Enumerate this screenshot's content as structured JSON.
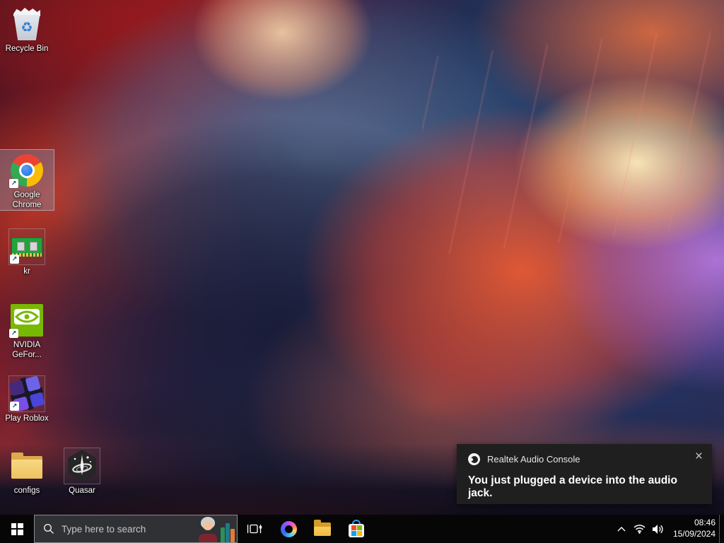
{
  "desktop_icons": {
    "recycle_bin": {
      "label": "Recycle Bin"
    },
    "google_chrome": {
      "line1": "Google",
      "line2": "Chrome",
      "selected": true
    },
    "kr": {
      "label": "kr"
    },
    "nvidia_geforce": {
      "line1": "NVIDIA",
      "line2": "GeFor..."
    },
    "play_roblox": {
      "label": "Play Roblox"
    },
    "configs": {
      "label": "configs"
    },
    "quasar": {
      "label": "Quasar"
    }
  },
  "notification": {
    "app_name": "Realtek Audio Console",
    "message": "You just plugged a device into the audio jack.",
    "close_glyph": "×"
  },
  "taskbar": {
    "search_placeholder": "Type here to search",
    "clock": {
      "time": "08:46",
      "date": "15/09/2024"
    }
  },
  "glyphs": {
    "recycle": "♻",
    "shortcut_arrow": "↗"
  },
  "colors": {
    "taskbar_bg": "#060606",
    "toast_bg": "#1f1f1f",
    "selection_fill": "rgba(125,155,185,0.38)",
    "selection_border": "rgba(185,210,235,0.65)",
    "nvidia_green": "#77b900",
    "folder_yellow": "#f3cf6f",
    "chrome_blue": "#1a73e8"
  }
}
